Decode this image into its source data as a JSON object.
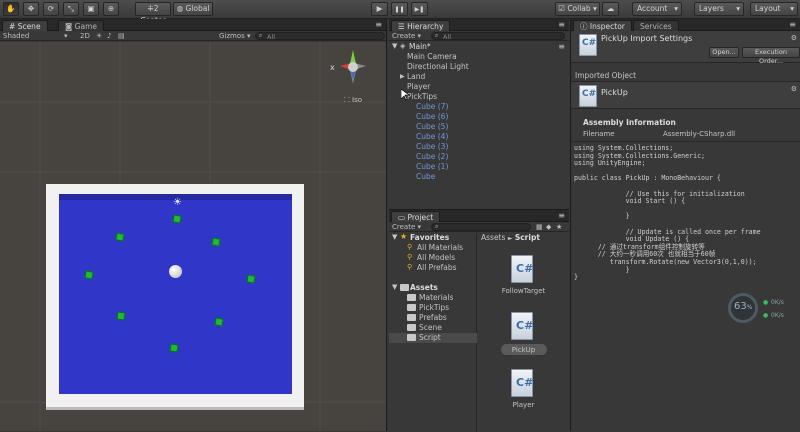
{
  "toolbar": {
    "pivot_label": "Center",
    "pivot_glyph": "⁜2",
    "space_label": "Global",
    "play_glyph": "▶",
    "pause_glyph": "❚❚",
    "step_glyph": "▶❚",
    "collab_label": "Collab ▾",
    "account_label": "Account",
    "layers_label": "Layers",
    "layout_label": "Layout"
  },
  "scene": {
    "tab_scene": "Scene",
    "tab_game": "Game",
    "shading": "Shaded",
    "mode_2d": "2D",
    "gizmos": "Gizmos ▾",
    "search_placeholder": "All",
    "iso_label": "Iso",
    "colors": {
      "plane": "#2f36c8",
      "border": "#f2f2f2",
      "cube": "#1fb83a"
    }
  },
  "hierarchy": {
    "tab": "Hierarchy",
    "create": "Create ▾",
    "search_placeholder": "All",
    "scene_name": "Main*",
    "items": [
      {
        "label": "Main Camera",
        "color": "normal"
      },
      {
        "label": "Directional Light",
        "color": "normal"
      },
      {
        "label": "Land",
        "color": "normal"
      },
      {
        "label": "Player",
        "color": "normal"
      },
      {
        "label": "PickTips",
        "color": "normal"
      },
      {
        "label": "Cube (7)",
        "color": "blue"
      },
      {
        "label": "Cube (6)",
        "color": "blue"
      },
      {
        "label": "Cube (5)",
        "color": "blue"
      },
      {
        "label": "Cube (4)",
        "color": "blue"
      },
      {
        "label": "Cube (3)",
        "color": "blue"
      },
      {
        "label": "Cube (2)",
        "color": "blue"
      },
      {
        "label": "Cube (1)",
        "color": "blue"
      },
      {
        "label": "Cube",
        "color": "blue"
      }
    ]
  },
  "project": {
    "tab": "Project",
    "create": "Create ▾",
    "favorites_label": "Favorites",
    "favorites": [
      "All Materials",
      "All Models",
      "All Prefabs"
    ],
    "assets_label": "Assets",
    "folders": [
      "Materials",
      "PickTips",
      "Prefabs",
      "Scene",
      "Script"
    ],
    "breadcrumb_root": "Assets",
    "breadcrumb_sep": "►",
    "breadcrumb_current": "Script",
    "files": [
      "FollowTarget",
      "PickUp",
      "Player"
    ]
  },
  "inspector": {
    "tab_inspector": "Inspector",
    "tab_services": "Services",
    "title": "PickUp Import Settings",
    "open_button": "Open...",
    "exec_order_button": "Execution Order...",
    "imported_object_label": "Imported Object",
    "object_name": "PickUp",
    "assembly_header": "Assembly Information",
    "filename_label": "Filename",
    "filename_value": "Assembly-CSharp.dll",
    "code": "using System.Collections;\nusing System.Collections.Generic;\nusing UnityEngine;\n\npublic class PickUp : MonoBehaviour {\n\n             // Use this for initialization\n             void Start () {\n\n             }\n\n             // Update is called once per frame\n             void Update () {\n      // 通过transform组件控制旋转等\n      // 大约一秒调用60次 也就相当于60帧\n         transform.Rotate(new Vector3(0,1,0));\n             }\n}",
    "fps_value": "63",
    "fps_unit": "%",
    "net_up": "0K/s",
    "net_down": "0K/s"
  }
}
